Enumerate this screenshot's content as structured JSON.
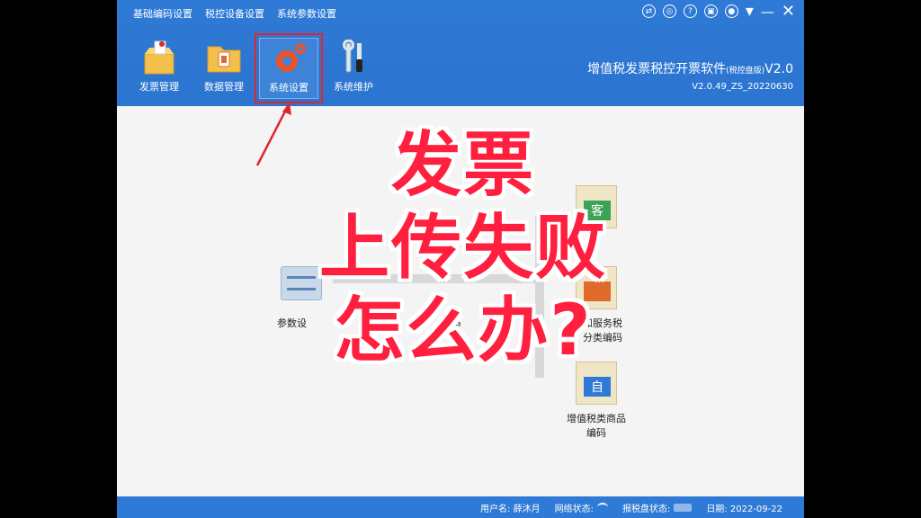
{
  "menu": [
    "基础编码设置",
    "税控设备设置",
    "系统参数设置"
  ],
  "tools": [
    {
      "label": "发票管理",
      "icon": "box-icon"
    },
    {
      "label": "数据管理",
      "icon": "folder-icon"
    },
    {
      "label": "系统设置",
      "icon": "gear-icon"
    },
    {
      "label": "系统维护",
      "icon": "wrench-icon"
    }
  ],
  "brand": {
    "title": "增值税发票税控开票软件",
    "edition": "(税控盘版)",
    "version_suffix": "V2.0",
    "build": "V2.0.49_ZS_20220630"
  },
  "cards": {
    "param": "参数设",
    "code": "码",
    "goods": "和服务税\n分类编码",
    "vat": "增值税类商品\n编码",
    "tag_a": "客",
    "tag_b": "自"
  },
  "overlay": [
    "发票",
    "上传失败",
    "怎么办?"
  ],
  "status": {
    "user_label": "用户名:",
    "user": "薛沐月",
    "net_label": "网络状态:",
    "disk_label": "报税盘状态:",
    "date_label": "日期:",
    "date": "2022-09-22"
  },
  "colors": {
    "accent": "#2f7ad6",
    "highlight": "#e0262b",
    "overlay_text": "#ff1f3e"
  }
}
